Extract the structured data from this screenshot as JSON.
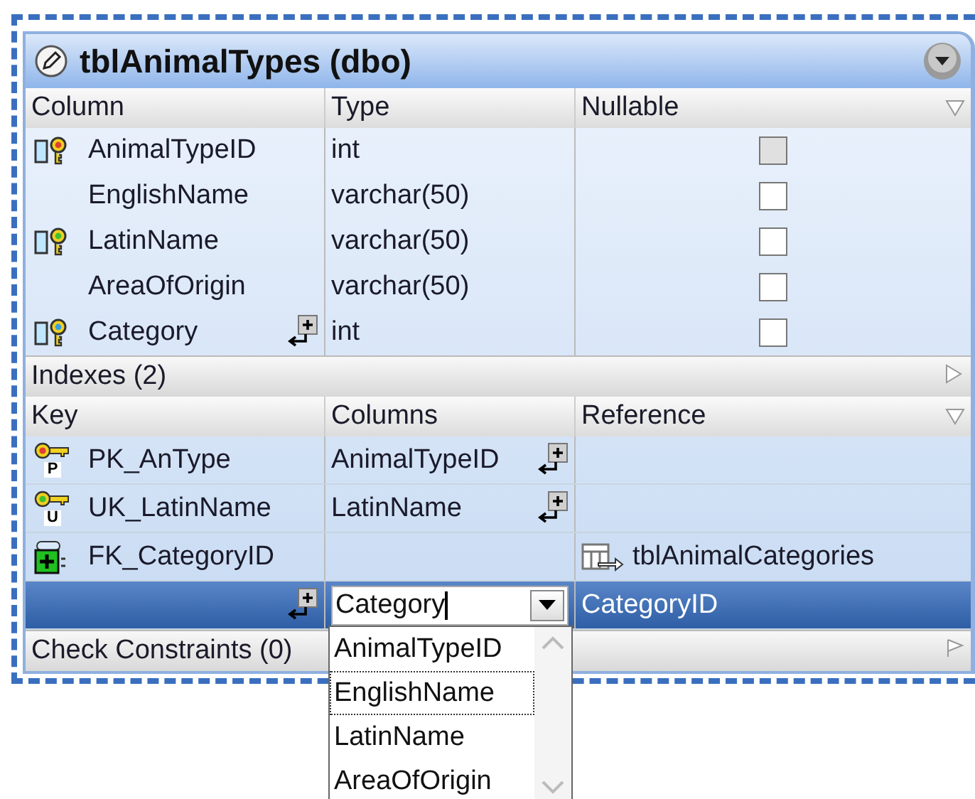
{
  "title": "tblAnimalTypes (dbo)",
  "columns_table": {
    "headers": [
      "Column",
      "Type",
      "Nullable"
    ],
    "rows": [
      {
        "kind": "primary",
        "name": "AnimalTypeID",
        "type": "int",
        "nullable": false,
        "disabled": true,
        "expand": false
      },
      {
        "kind": "none",
        "name": "EnglishName",
        "type": "varchar(50)",
        "nullable": false,
        "disabled": false,
        "expand": false
      },
      {
        "kind": "unique",
        "name": "LatinName",
        "type": "varchar(50)",
        "nullable": false,
        "disabled": false,
        "expand": false
      },
      {
        "kind": "none",
        "name": "AreaOfOrigin",
        "type": "varchar(50)",
        "nullable": false,
        "disabled": false,
        "expand": false
      },
      {
        "kind": "foreign",
        "name": "Category",
        "type": "int",
        "nullable": false,
        "disabled": false,
        "expand": true
      }
    ]
  },
  "indexes": {
    "title": "Indexes (2)",
    "expanded": true,
    "headers": [
      "Key",
      "Columns",
      "Reference"
    ],
    "rows": [
      {
        "kind": "primary",
        "badge": "P",
        "name": "PK_AnType",
        "columns": "AnimalTypeID",
        "expand": true,
        "selected": false
      },
      {
        "kind": "unique",
        "badge": "U",
        "name": "UK_LatinName",
        "columns": "LatinName",
        "expand": true,
        "selected": false
      },
      {
        "kind": "foreign",
        "name": "FK_CategoryID",
        "expand": false,
        "reference": "tblAnimalCategories",
        "selected": false
      },
      {
        "kind": "mapping",
        "columns": "Category",
        "expand": true,
        "reference": "CategoryID",
        "selected": true,
        "dropdown": [
          {
            "label": "AnimalTypeID",
            "focused": false
          },
          {
            "label": "EnglishName",
            "focused": true
          },
          {
            "label": "LatinName",
            "focused": false
          },
          {
            "label": "AreaOfOrigin",
            "focused": false
          }
        ]
      }
    ]
  },
  "check_constraints": {
    "title": "Check Constraints (0)",
    "expanded": false
  }
}
